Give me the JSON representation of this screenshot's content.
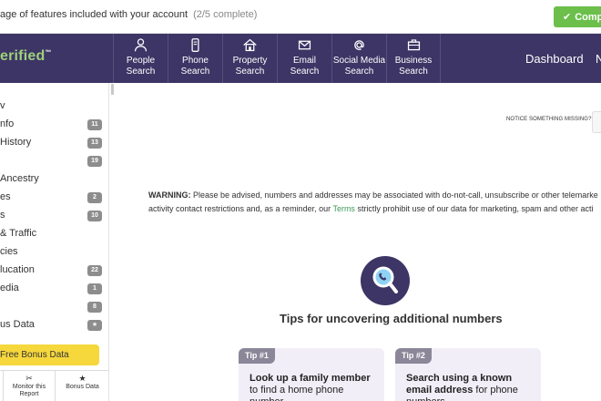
{
  "progress": {
    "text": "age of features included with your account",
    "count": "(2/5 complete)",
    "complete_label": "Compl"
  },
  "brand": {
    "logo_text": "erified",
    "logo_mark": "™"
  },
  "nav": {
    "items": [
      {
        "line1": "People",
        "line2": "Search",
        "icon": "person-icon"
      },
      {
        "line1": "Phone",
        "line2": "Search",
        "icon": "phone-icon"
      },
      {
        "line1": "Property",
        "line2": "Search",
        "icon": "house-icon"
      },
      {
        "line1": "Email",
        "line2": "Search",
        "icon": "envelope-icon"
      },
      {
        "line1": "Social Media",
        "line2": "Search",
        "icon": "at-icon"
      },
      {
        "line1": "Business",
        "line2": "Search",
        "icon": "briefcase-icon"
      }
    ],
    "dashboard": "Dashboard",
    "extra": "N"
  },
  "sidebar": {
    "items": [
      {
        "label": "v",
        "badge": ""
      },
      {
        "label": "nfo",
        "badge": "11"
      },
      {
        "label": "History",
        "badge": "13"
      },
      {
        "label": "",
        "badge": "19"
      },
      {
        "label": "Ancestry",
        "badge": ""
      },
      {
        "label": "es",
        "badge": "2"
      },
      {
        "label": "s",
        "badge": "10"
      },
      {
        "label": "& Traffic",
        "badge": ""
      },
      {
        "label": "cies",
        "badge": ""
      },
      {
        "label": "lucation",
        "badge": "22"
      },
      {
        "label": "edia",
        "badge": "1"
      },
      {
        "label": "",
        "badge": "8"
      },
      {
        "label": "us Data",
        "badge": "★"
      }
    ],
    "free_bonus": "Free Bonus Data",
    "tools": [
      {
        "icon": "▮",
        "label": ""
      },
      {
        "icon": "✂",
        "label": "Monitor this Report"
      },
      {
        "icon": "★",
        "label": "Bonus Data"
      }
    ]
  },
  "main": {
    "notice": "NOTICE SOMETHING MISSING?",
    "warning_label": "WARNING:",
    "warning_line1": " Please be advised, numbers and addresses may be associated with do-not-call, unsubscribe or other telemarke",
    "warning_line2_a": "activity contact restrictions and, as a reminder, our ",
    "warning_terms": "Terms",
    "warning_line2_b": " strictly prohibit use of our data for marketing, spam and other acti",
    "tips_title": "Tips for uncovering additional numbers",
    "tips": [
      {
        "tag": "Tip #1",
        "bold": "Look up a family member",
        "rest": " to find a home phone number"
      },
      {
        "tag": "Tip #2",
        "bold": "Search using a known email address",
        "rest": " for phone numbers"
      }
    ]
  }
}
